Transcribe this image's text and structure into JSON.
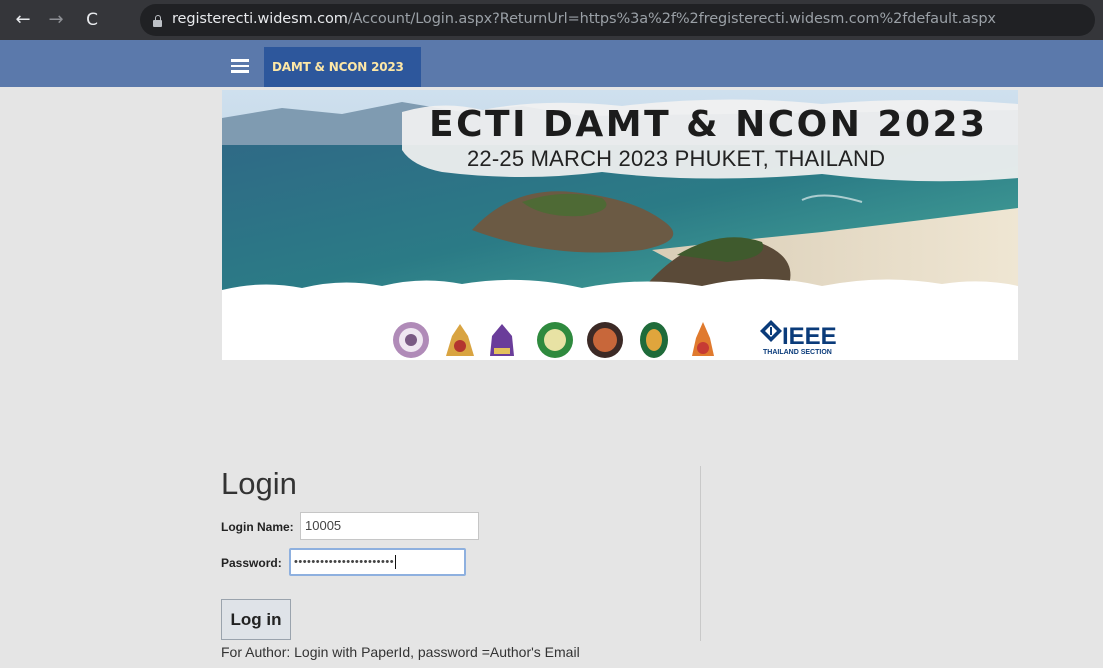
{
  "browser": {
    "back_icon": "arrow-left-icon",
    "forward_icon": "arrow-right-icon",
    "reload_icon": "reload-icon",
    "lock_icon": "lock-icon",
    "url_host": "registerecti.widesm.com",
    "url_path": "/Account/Login.aspx?ReturnUrl=https%3a%2f%2fregisterecti.widesm.com%2fdefault.aspx"
  },
  "navbar": {
    "menu_icon": "hamburger-menu-icon",
    "brand": "DAMT & NCON 2023",
    "color": "#5b79ab",
    "brand_color": "#2d579c"
  },
  "banner": {
    "title": "ECTI DAMT & NCON 2023",
    "subtitle": "22-25 MARCH 2023  PHUKET, THAILAND",
    "ieee_text": "IEEE",
    "ieee_sub": "THAILAND SECTION"
  },
  "login": {
    "title": "Login",
    "name_label": "Login Name:",
    "name_value": "10005",
    "password_label": "Password:",
    "password_masked": "•••••••••••••••••••••••",
    "button_label": "Log in",
    "hint": "For Author: Login with PaperId, password =Author's Email"
  }
}
